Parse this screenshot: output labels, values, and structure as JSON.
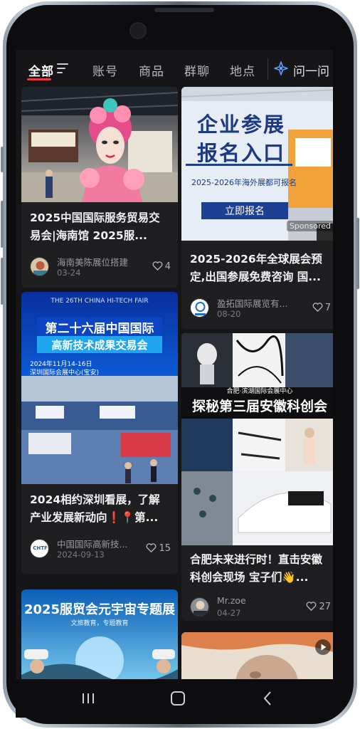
{
  "tabs": [
    {
      "label": "全部",
      "active": true
    },
    {
      "label": "账号"
    },
    {
      "label": "商品"
    },
    {
      "label": "群聊"
    },
    {
      "label": "地点"
    }
  ],
  "ask_button": {
    "label": "问一问",
    "icon": "ai-sparkle-icon"
  },
  "cards": [
    {
      "title": "2025中国国际服务贸易交易会|海南馆 2025服...",
      "author": "海南美陈展位搭建",
      "date": "03-24",
      "likes": "4",
      "cover": "colorful exhibition hall with opera face sculpture"
    },
    {
      "title": "2025-2026年全球展会预定,出国参展免费咨询 国...",
      "author": "盈拓国际展览有...",
      "date": "08-20",
      "likes": "7",
      "cover_text": {
        "headline_1": "企业参展",
        "headline_2": "报名入口",
        "sub": "2025-2026年海外展都可报名",
        "button": "立即报名",
        "badge": "Sponsored"
      }
    },
    {
      "title": "2024相约深圳看展，了解产业发展新动向❗📍第...",
      "author": "中国国际高新技...",
      "date": "2024-09-13",
      "likes": "15",
      "cover_text": {
        "en": "THE 26TH CHINA HI-TECH FAIR",
        "headline_1": "第二十六届中国国际",
        "headline_2": "高新技术成果交易会",
        "date_line": "2024年11月14-16日",
        "venue": "深圳国际会展中心(宝安)"
      },
      "avatar_text": "CHTF"
    },
    {
      "title": "合肥未来进行时！直击安徽科创会现场 宝子们👋...",
      "author": "Mr.zoe",
      "date": "04-27",
      "likes": "27",
      "cover_text": {
        "small": "合肥·滨湖国际会展中心",
        "headline": "探秘第三届安徽科创会"
      }
    },
    {
      "cover_text": {
        "headline": "2025服贸会元宇宙专题展",
        "sub": "文旅教育，专题教育"
      }
    },
    {
      "cover": "video thumbnail with play button"
    }
  ],
  "colors": {
    "background": "#161618",
    "card": "#1f1f22",
    "accent_red": "#e53a48",
    "text_primary": "#f2f2f4",
    "text_secondary": "#9a9aa0"
  },
  "nav": {
    "recent": "recent-apps-icon",
    "home": "home-icon",
    "back": "back-icon"
  }
}
